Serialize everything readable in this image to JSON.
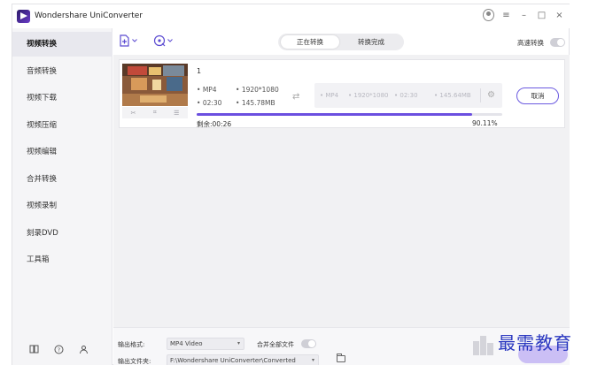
{
  "app": {
    "title": "Wondershare UniConverter"
  },
  "window_controls": {
    "user": "user-icon",
    "menu": "≡",
    "minimize": "–",
    "maximize": "□",
    "close": "×"
  },
  "sidebar": {
    "items": [
      {
        "label": "视频转换",
        "active": true
      },
      {
        "label": "音频转换"
      },
      {
        "label": "视频下载"
      },
      {
        "label": "视频压缩"
      },
      {
        "label": "视频编辑"
      },
      {
        "label": "合并转换"
      },
      {
        "label": "视频录制"
      },
      {
        "label": "刻录DVD"
      },
      {
        "label": "工具箱"
      }
    ],
    "bottom_icons": [
      "book-icon",
      "help-icon",
      "people-icon"
    ]
  },
  "toolbar": {
    "add_file_icon": "add-file-icon",
    "add_from_device_icon": "add-device-icon",
    "tabs": [
      {
        "label": "正在转换",
        "active": true
      },
      {
        "label": "转换完成"
      }
    ],
    "high_speed_label": "高速转换",
    "high_speed_on": false
  },
  "task": {
    "name": "1",
    "source": {
      "format": "MP4",
      "resolution": "1920*1080",
      "duration": "02:30",
      "size": "145.78MB"
    },
    "target": {
      "format": "MP4",
      "resolution": "1920*1080",
      "duration": "02:30",
      "size": "145.64MB"
    },
    "cancel_label": "取消",
    "progress_percent": 90.11,
    "progress_label": "90.11%",
    "remaining_label": "剩余:00:26",
    "edit_icons": [
      "cut-icon",
      "crop-icon",
      "effects-icon"
    ]
  },
  "bottom": {
    "output_format_label": "输出格式:",
    "output_format_value": "MP4 Video",
    "merge_label": "合并全部文件",
    "merge_on": false,
    "output_folder_label": "输出文件夹:",
    "output_folder_value": "F:\\Wondershare UniConverter\\Converted"
  },
  "watermark": {
    "text": "最需教育"
  },
  "colors": {
    "accent": "#6b4fe0",
    "sidebar_bg": "#f5f5f7",
    "content_bg": "#f1f1f3",
    "watermark": "#2a37c0"
  }
}
